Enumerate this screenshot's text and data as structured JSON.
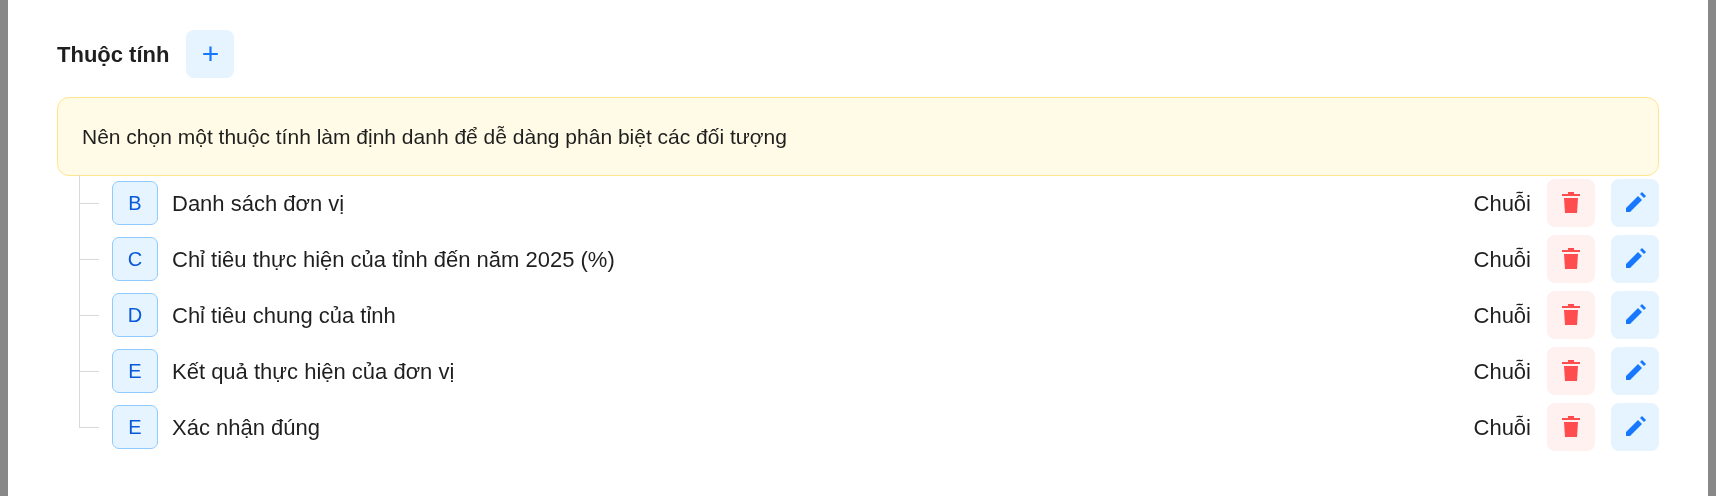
{
  "section": {
    "title": "Thuộc tính",
    "add_button": "+"
  },
  "notice": "Nên chọn một thuộc tính làm định danh để dễ dàng phân biệt các đối tượng",
  "attributes": [
    {
      "badge": "B",
      "name": "Danh sách đơn vị",
      "type": "Chuỗi"
    },
    {
      "badge": "C",
      "name": "Chỉ tiêu thực hiện của tỉnh đến năm 2025 (%)",
      "type": "Chuỗi"
    },
    {
      "badge": "D",
      "name": "Chỉ tiêu chung của tỉnh",
      "type": "Chuỗi"
    },
    {
      "badge": "E",
      "name": "Kết quả thực hiện của đơn vị",
      "type": "Chuỗi"
    },
    {
      "badge": "E",
      "name": "Xác nhận đúng",
      "type": "Chuỗi"
    }
  ]
}
